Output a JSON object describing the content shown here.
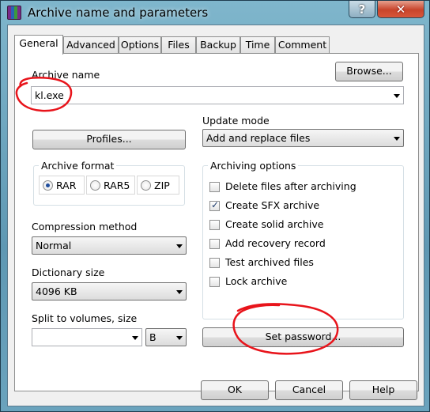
{
  "window": {
    "title": "Archive name and parameters",
    "help_glyph": "?",
    "close_glyph": "✕"
  },
  "tabs": [
    {
      "label": "General",
      "active": true
    },
    {
      "label": "Advanced"
    },
    {
      "label": "Options"
    },
    {
      "label": "Files"
    },
    {
      "label": "Backup"
    },
    {
      "label": "Time"
    },
    {
      "label": "Comment"
    }
  ],
  "general": {
    "archive_name_label": "Archive name",
    "archive_name_value": "kl.exe",
    "browse_button": "Browse...",
    "profiles_button": "Profiles...",
    "update_mode_label": "Update mode",
    "update_mode_value": "Add and replace files",
    "archive_format": {
      "title": "Archive format",
      "options": [
        "RAR",
        "RAR5",
        "ZIP"
      ],
      "selected": "RAR"
    },
    "archiving_options": {
      "title": "Archiving options",
      "items": [
        {
          "label": "Delete files after archiving",
          "checked": false
        },
        {
          "label": "Create SFX archive",
          "checked": true
        },
        {
          "label": "Create solid archive",
          "checked": false
        },
        {
          "label": "Add recovery record",
          "checked": false
        },
        {
          "label": "Test archived files",
          "checked": false
        },
        {
          "label": "Lock archive",
          "checked": false
        }
      ]
    },
    "compression_method_label": "Compression method",
    "compression_method_value": "Normal",
    "dictionary_size_label": "Dictionary size",
    "dictionary_size_value": "4096 KB",
    "split_label": "Split to volumes, size",
    "split_value": "",
    "split_unit": "B",
    "set_password_button": "Set password..."
  },
  "footer": {
    "ok": "OK",
    "cancel": "Cancel",
    "help": "Help"
  },
  "colors": {
    "annotation": "#e8141b",
    "checkmark": "#1f3d6e"
  }
}
